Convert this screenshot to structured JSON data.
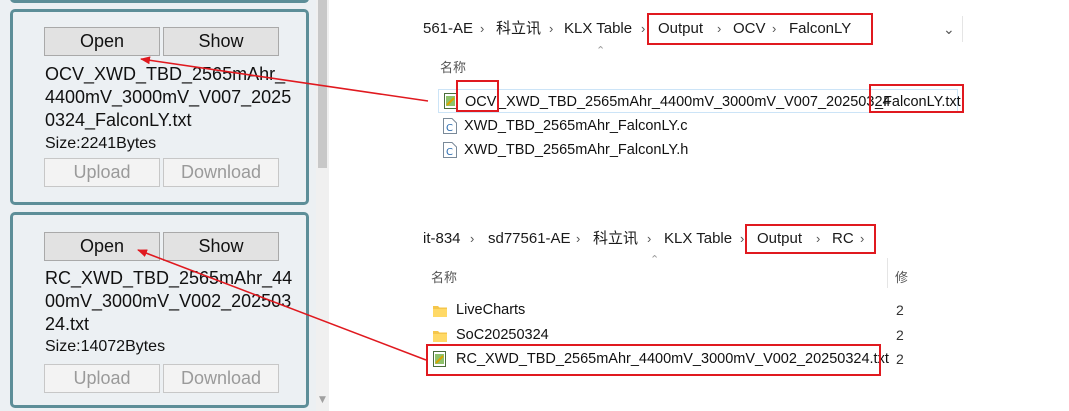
{
  "left_panel": {
    "cards": [
      {
        "open_label": "Open",
        "show_label": "Show",
        "filename": "OCV_XWD_TBD_2565mAhr_4400mV_3000mV_V007_20250324_FalconLY.txt",
        "size": "Size:2241Bytes",
        "upload_label": "Upload",
        "download_label": "Download"
      },
      {
        "open_label": "Open",
        "show_label": "Show",
        "filename": "RC_XWD_TBD_2565mAhr_4400mV_3000mV_V002_20250324.txt",
        "size": "Size:14072Bytes",
        "upload_label": "Upload",
        "download_label": "Download"
      }
    ]
  },
  "explorer_top": {
    "breadcrumb": [
      "561-AE",
      "科立讯",
      "KLX Table",
      "Output",
      "OCV",
      "FalconLY"
    ],
    "column_name": "名称",
    "files": [
      {
        "name_prefix": "OCV",
        "name_middle": "_XWD_TBD_2565mAhr_4400mV_3000mV_V007_20250324",
        "name_suffix": "_FalconLY.txt",
        "icon": "text-file-icon"
      },
      {
        "name": "XWD_TBD_2565mAhr_FalconLY.c",
        "icon": "c-source-file-icon"
      },
      {
        "name": "XWD_TBD_2565mAhr_FalconLY.h",
        "icon": "c-source-file-icon"
      }
    ]
  },
  "explorer_bottom": {
    "breadcrumb": [
      "it-834",
      "sd77561-AE",
      "科立讯",
      "KLX Table",
      "Output",
      "RC"
    ],
    "column_name": "名称",
    "column_date": "修",
    "files": [
      {
        "name": "LiveCharts",
        "icon": "folder-icon",
        "date": "2"
      },
      {
        "name": "SoC20250324",
        "icon": "folder-icon",
        "date": "2"
      },
      {
        "name": "RC_XWD_TBD_2565mAhr_4400mV_3000mV_V002_20250324.txt",
        "icon": "text-file-icon",
        "date": "2"
      }
    ]
  },
  "colors": {
    "card_border": "#5d8e98",
    "highlight_red": "#e0191f",
    "panel_bg": "#ecf0f3"
  }
}
